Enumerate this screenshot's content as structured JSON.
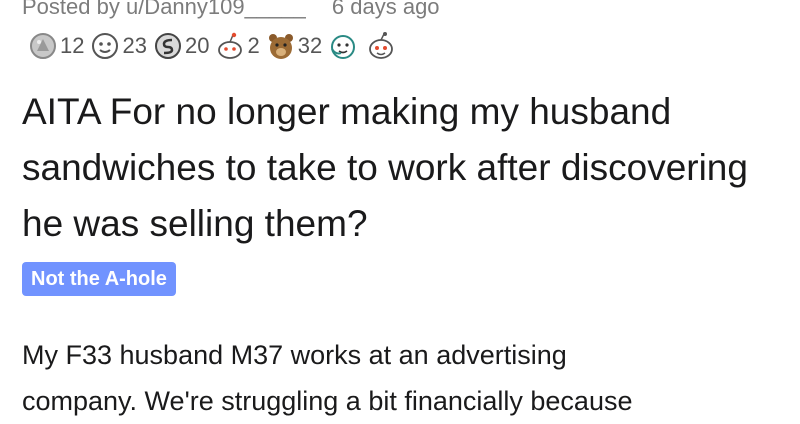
{
  "post": {
    "posted_by": "Posted by u/Danny109_____",
    "time_ago": "6 days ago",
    "title": "AITA For no longer making my husband sandwiches to take to work after discovering he was selling them?",
    "flair": "Not the A-hole",
    "body_line1": "My F33 husband M37 works at an advertising",
    "body_line2": "company. We're struggling a bit financially because"
  },
  "awards": [
    {
      "icon": "silver-award-icon",
      "count": "12"
    },
    {
      "icon": "helpful-award-icon",
      "count": "23"
    },
    {
      "icon": "wholesome-seal-award-icon",
      "count": "20"
    },
    {
      "icon": "snoo-award-icon",
      "count": "2"
    },
    {
      "icon": "bear-award-icon",
      "count": "32"
    },
    {
      "icon": "hugz-award-icon",
      "count": ""
    },
    {
      "icon": "snoo-face-award-icon",
      "count": ""
    }
  ],
  "colors": {
    "flair_bg": "#7193ff",
    "meta_text": "#7c7c7c",
    "title_text": "#1a1a1b"
  }
}
